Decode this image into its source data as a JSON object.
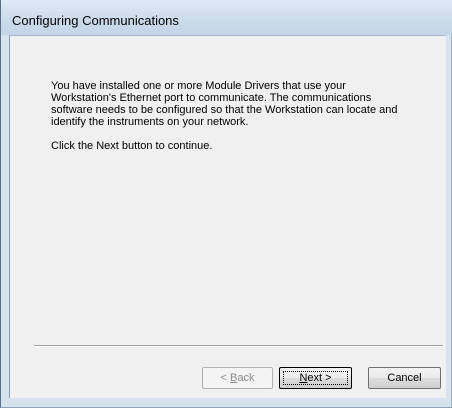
{
  "window": {
    "title": "Configuring Communications"
  },
  "message": {
    "body": "You have installed one or more Module Drivers that use your Workstation's Ethernet port to communicate.  The communications software needs to be configured so that the Workstation can locate and identify the instruments on your network.",
    "instruction": "Click the Next button to continue."
  },
  "buttons": {
    "back": {
      "prefix": "< ",
      "mnemonic": "B",
      "suffix": "ack",
      "enabled": false
    },
    "next": {
      "mnemonic": "N",
      "suffix": "ext >",
      "enabled": true,
      "default": true
    },
    "cancel": {
      "label": "Cancel",
      "enabled": true
    }
  },
  "colors": {
    "frame": "#d6e2ee",
    "client": "#f0f0f0",
    "disabled_text": "#8d8d8d"
  }
}
